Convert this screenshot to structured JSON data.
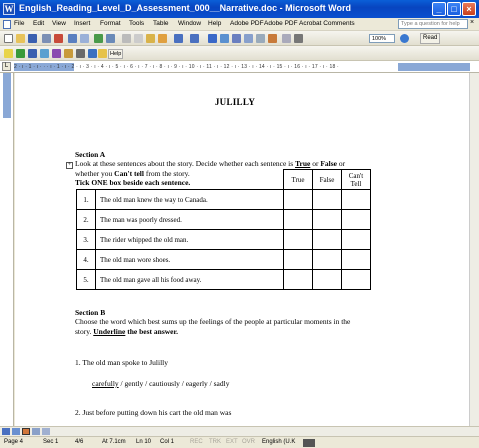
{
  "window": {
    "title": "English_Reading_Level_D_Assessment_000__Narrative.doc - Microsoft Word",
    "icon_letter": "W"
  },
  "menubar": {
    "items": [
      "File",
      "Edit",
      "View",
      "Insert",
      "Format",
      "Tools",
      "Table",
      "Window",
      "Help",
      "Adobe PDF",
      "Acrobat Comments"
    ],
    "help_placeholder": "Type a question for help"
  },
  "toolbar": {
    "zoom": "100%",
    "read_label": "Read",
    "help_label": "Help"
  },
  "ruler": {
    "scale": "2 · ı · 1 · ı ·  ·  · ı · 1 · ı · 2 · ı · 3 · ı · 4 · ı · 5 · ı · 6 · ı · 7 · ı · 8 · ı · 9 · ı · 10 · ı · 11 · ı · 12 · ı · 13 · ı · 14 · ı · 15 · ı · 16 · ı · 17 · ı · 18 ·"
  },
  "document": {
    "title": "JULILLY",
    "sectionA": {
      "heading": "Section A",
      "line1_pre": "Look at these sentences about the story.  Decide whether each sentence is ",
      "true_word": "True",
      "or_word": " or ",
      "false_word": "False",
      "line1_post": " or",
      "line2_pre": "whether you ",
      "cant_tell": "Can't tell",
      "line2_post": " from the story.",
      "instruction": "Tick ONE box beside each sentence."
    },
    "table": {
      "headers": [
        "True",
        "False",
        "Can't Tell"
      ],
      "rows": [
        {
          "num": "1.",
          "text": "The old man knew the way to Canada."
        },
        {
          "num": "2.",
          "text": "The man was poorly dressed."
        },
        {
          "num": "3.",
          "text": "The rider whipped the old man."
        },
        {
          "num": "4.",
          "text": "The old man wore shoes."
        },
        {
          "num": "5.",
          "text": "The old man gave all his food away."
        }
      ]
    },
    "sectionB": {
      "heading": "Section B",
      "line1": "Choose the word which best sums up the feelings of the people at particular moments in the",
      "line2_pre": "story.  ",
      "underline_word": "Underline",
      "line2_post": " the best answer.",
      "q1": "1.  The old man spoke to Julilly",
      "q1_first_option": "carefully",
      "q1_rest_options": " /  gently  /  cautiously  /  eagerly  /  sadly",
      "q2": "2.  Just before putting down his cart the old man was"
    }
  },
  "status": {
    "page": "Page  4",
    "sec": "Sec  1",
    "pages": "4/6",
    "at": "At  7.1cm",
    "ln": "Ln  10",
    "col": "Col  1",
    "rec": "REC",
    "trk": "TRK",
    "ext": "EXT",
    "ovr": "OVR",
    "lang": "English (U.K"
  }
}
